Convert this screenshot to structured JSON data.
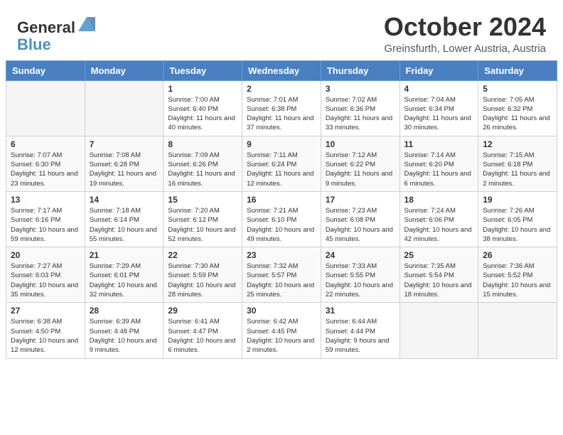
{
  "header": {
    "logo_general": "General",
    "logo_blue": "Blue",
    "month_title": "October 2024",
    "location": "Greinsfurth, Lower Austria, Austria"
  },
  "weekdays": [
    "Sunday",
    "Monday",
    "Tuesday",
    "Wednesday",
    "Thursday",
    "Friday",
    "Saturday"
  ],
  "weeks": [
    [
      {
        "day": "",
        "empty": true
      },
      {
        "day": "",
        "empty": true
      },
      {
        "day": "1",
        "sunrise": "7:00 AM",
        "sunset": "6:40 PM",
        "daylight": "11 hours and 40 minutes."
      },
      {
        "day": "2",
        "sunrise": "7:01 AM",
        "sunset": "6:38 PM",
        "daylight": "11 hours and 37 minutes."
      },
      {
        "day": "3",
        "sunrise": "7:02 AM",
        "sunset": "6:36 PM",
        "daylight": "11 hours and 33 minutes."
      },
      {
        "day": "4",
        "sunrise": "7:04 AM",
        "sunset": "6:34 PM",
        "daylight": "11 hours and 30 minutes."
      },
      {
        "day": "5",
        "sunrise": "7:05 AM",
        "sunset": "6:32 PM",
        "daylight": "11 hours and 26 minutes."
      }
    ],
    [
      {
        "day": "6",
        "sunrise": "7:07 AM",
        "sunset": "6:30 PM",
        "daylight": "11 hours and 23 minutes."
      },
      {
        "day": "7",
        "sunrise": "7:08 AM",
        "sunset": "6:28 PM",
        "daylight": "11 hours and 19 minutes."
      },
      {
        "day": "8",
        "sunrise": "7:09 AM",
        "sunset": "6:26 PM",
        "daylight": "11 hours and 16 minutes."
      },
      {
        "day": "9",
        "sunrise": "7:11 AM",
        "sunset": "6:24 PM",
        "daylight": "11 hours and 12 minutes."
      },
      {
        "day": "10",
        "sunrise": "7:12 AM",
        "sunset": "6:22 PM",
        "daylight": "11 hours and 9 minutes."
      },
      {
        "day": "11",
        "sunrise": "7:14 AM",
        "sunset": "6:20 PM",
        "daylight": "11 hours and 6 minutes."
      },
      {
        "day": "12",
        "sunrise": "7:15 AM",
        "sunset": "6:18 PM",
        "daylight": "11 hours and 2 minutes."
      }
    ],
    [
      {
        "day": "13",
        "sunrise": "7:17 AM",
        "sunset": "6:16 PM",
        "daylight": "10 hours and 59 minutes."
      },
      {
        "day": "14",
        "sunrise": "7:18 AM",
        "sunset": "6:14 PM",
        "daylight": "10 hours and 55 minutes."
      },
      {
        "day": "15",
        "sunrise": "7:20 AM",
        "sunset": "6:12 PM",
        "daylight": "10 hours and 52 minutes."
      },
      {
        "day": "16",
        "sunrise": "7:21 AM",
        "sunset": "6:10 PM",
        "daylight": "10 hours and 49 minutes."
      },
      {
        "day": "17",
        "sunrise": "7:23 AM",
        "sunset": "6:08 PM",
        "daylight": "10 hours and 45 minutes."
      },
      {
        "day": "18",
        "sunrise": "7:24 AM",
        "sunset": "6:06 PM",
        "daylight": "10 hours and 42 minutes."
      },
      {
        "day": "19",
        "sunrise": "7:26 AM",
        "sunset": "6:05 PM",
        "daylight": "10 hours and 38 minutes."
      }
    ],
    [
      {
        "day": "20",
        "sunrise": "7:27 AM",
        "sunset": "6:03 PM",
        "daylight": "10 hours and 35 minutes."
      },
      {
        "day": "21",
        "sunrise": "7:29 AM",
        "sunset": "6:01 PM",
        "daylight": "10 hours and 32 minutes."
      },
      {
        "day": "22",
        "sunrise": "7:30 AM",
        "sunset": "5:59 PM",
        "daylight": "10 hours and 28 minutes."
      },
      {
        "day": "23",
        "sunrise": "7:32 AM",
        "sunset": "5:57 PM",
        "daylight": "10 hours and 25 minutes."
      },
      {
        "day": "24",
        "sunrise": "7:33 AM",
        "sunset": "5:55 PM",
        "daylight": "10 hours and 22 minutes."
      },
      {
        "day": "25",
        "sunrise": "7:35 AM",
        "sunset": "5:54 PM",
        "daylight": "10 hours and 18 minutes."
      },
      {
        "day": "26",
        "sunrise": "7:36 AM",
        "sunset": "5:52 PM",
        "daylight": "10 hours and 15 minutes."
      }
    ],
    [
      {
        "day": "27",
        "sunrise": "6:38 AM",
        "sunset": "4:50 PM",
        "daylight": "10 hours and 12 minutes."
      },
      {
        "day": "28",
        "sunrise": "6:39 AM",
        "sunset": "4:48 PM",
        "daylight": "10 hours and 9 minutes."
      },
      {
        "day": "29",
        "sunrise": "6:41 AM",
        "sunset": "4:47 PM",
        "daylight": "10 hours and 6 minutes."
      },
      {
        "day": "30",
        "sunrise": "6:42 AM",
        "sunset": "4:45 PM",
        "daylight": "10 hours and 2 minutes."
      },
      {
        "day": "31",
        "sunrise": "6:44 AM",
        "sunset": "4:44 PM",
        "daylight": "9 hours and 59 minutes."
      },
      {
        "day": "",
        "empty": true
      },
      {
        "day": "",
        "empty": true
      }
    ]
  ]
}
